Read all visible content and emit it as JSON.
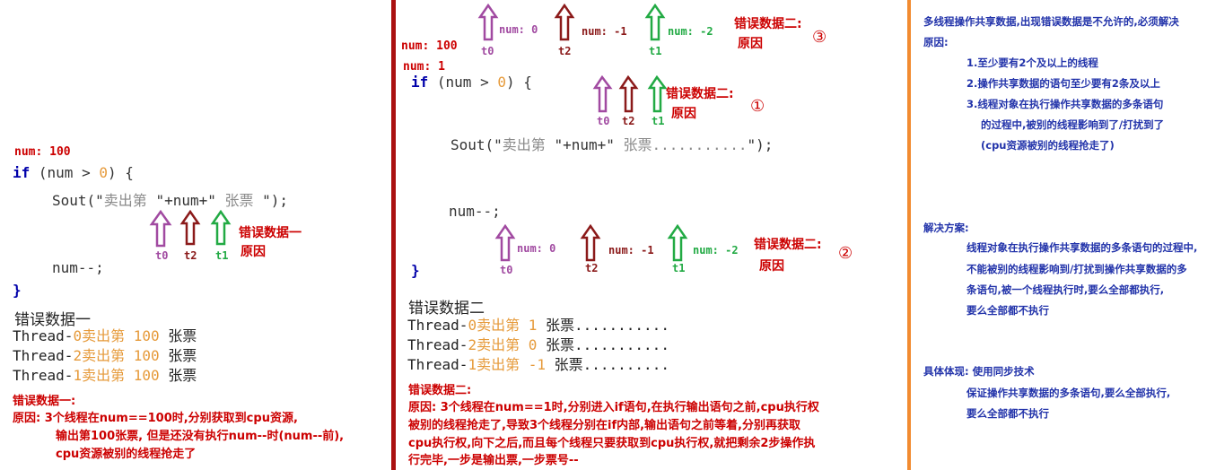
{
  "colors": {
    "divider1": "#aa1111",
    "divider2": "#f28b30",
    "purple": "#a14aa1",
    "maroon": "#8b1a1a",
    "green": "#22aa44",
    "red": "#cc0000",
    "blue": "#2233aa"
  },
  "left": {
    "num_label": "num: 100",
    "if_kw": "if",
    "if_cond": " (num > ",
    "if_zero": "0",
    "if_end": ") {",
    "sout_prefix": "Sout(\"",
    "sout_cn": "卖出第 ",
    "sout_mid": "\"+num+\"",
    "sout_cn2": " 张票 ",
    "sout_end": "\");",
    "decrement": "num--;",
    "close_brace": "}",
    "arrows": {
      "t0": "t0",
      "t2": "t2",
      "t1": "t1"
    },
    "err_label_1": "错误数据一",
    "err_label_2": "原因",
    "result_title": "错误数据一",
    "results": [
      {
        "thread": "Thread-",
        "id": "0",
        "msg": "卖出第 100 ",
        "ticket": "张票"
      },
      {
        "thread": "Thread-",
        "id": "2",
        "msg": "卖出第 100 ",
        "ticket": "张票"
      },
      {
        "thread": "Thread-",
        "id": "1",
        "msg": "卖出第 100 ",
        "ticket": "张票"
      }
    ],
    "reason_title": "错误数据一:",
    "reason_lines": [
      "原因: 3个线程在num==100时,分别获取到cpu资源,",
      "输出第100张票, 但是还没有执行num--时(num--前),",
      "cpu资源被别的线程抢走了"
    ]
  },
  "middle": {
    "top_arrows": {
      "t0": "t0",
      "num0": "num: 0",
      "t2": "t2",
      "num_m1": "num: -1",
      "t1": "t1",
      "num_m2": "num: -2"
    },
    "top_err": "错误数据二:",
    "top_reason": "原因",
    "circle3": "③",
    "num100": "num: 100",
    "num1": "num: 1",
    "if_kw": "if",
    "if_cond": " (num > ",
    "if_zero": "0",
    "if_end": ") {",
    "mid_arrows": {
      "t0": "t0",
      "t2": "t2",
      "t1": "t1"
    },
    "mid_err": "错误数据二:",
    "mid_reason": "原因",
    "circle1": "①",
    "sout_prefix": "Sout(\"",
    "sout_cn": "卖出第 ",
    "sout_mid": "\"+num+\"",
    "sout_cn2": " 张票...........",
    "sout_end": "\");",
    "decrement": "num--;",
    "bot_arrows": {
      "t0": "t0",
      "num0": "num: 0",
      "t2": "t2",
      "num_m1": "num: -1",
      "t1": "t1",
      "num_m2": "num: -2"
    },
    "bot_err": "错误数据二:",
    "bot_reason": "原因",
    "circle2": "②",
    "close_brace": "}",
    "result_title": "错误数据二",
    "results": [
      {
        "thread": "Thread-",
        "id": "0",
        "msg": "卖出第 1 ",
        "ticket": "张票..........."
      },
      {
        "thread": "Thread-",
        "id": "2",
        "msg": "卖出第 0 ",
        "ticket": "张票..........."
      },
      {
        "thread": "Thread-",
        "id": "1",
        "msg": "卖出第 -1 ",
        "ticket": "张票.........."
      }
    ],
    "reason_title": "错误数据二:",
    "reason_lines": [
      "原因: 3个线程在num==1时,分别进入if语句,在执行输出语句之前,cpu执行权",
      "被别的线程抢走了,导致3个线程分别在if内部,输出语句之前等着,分别再获取",
      "cpu执行权,向下之后,而且每个线程只要获取到cpu执行权,就把剩余2步操作执",
      "行完毕,一步是输出票,一步票号--"
    ]
  },
  "right": {
    "intro_line1": "多线程操作共享数据,出现错误数据是不允许的,必须解决",
    "intro_line2": "原因:",
    "reasons": [
      "1.至少要有2个及以上的线程",
      "2.操作共享数据的语句至少要有2条及以上",
      "3.线程对象在执行操作共享数据的多条语句",
      "的过程中,被别的线程影响到了/打扰到了",
      "(cpu资源被别的线程抢走了)"
    ],
    "solution_title": "解决方案:",
    "solution_lines": [
      "线程对象在执行操作共享数据的多条语句的过程中,",
      "不能被别的线程影响到/打扰到操作共享数据的多",
      "条语句,被一个线程执行时,要么全部都执行,",
      "要么全部都不执行"
    ],
    "impl_title": "具体体现: 使用同步技术",
    "impl_lines": [
      "保证操作共享数据的多条语句,要么全部执行,",
      "要么全部都不执行"
    ]
  }
}
